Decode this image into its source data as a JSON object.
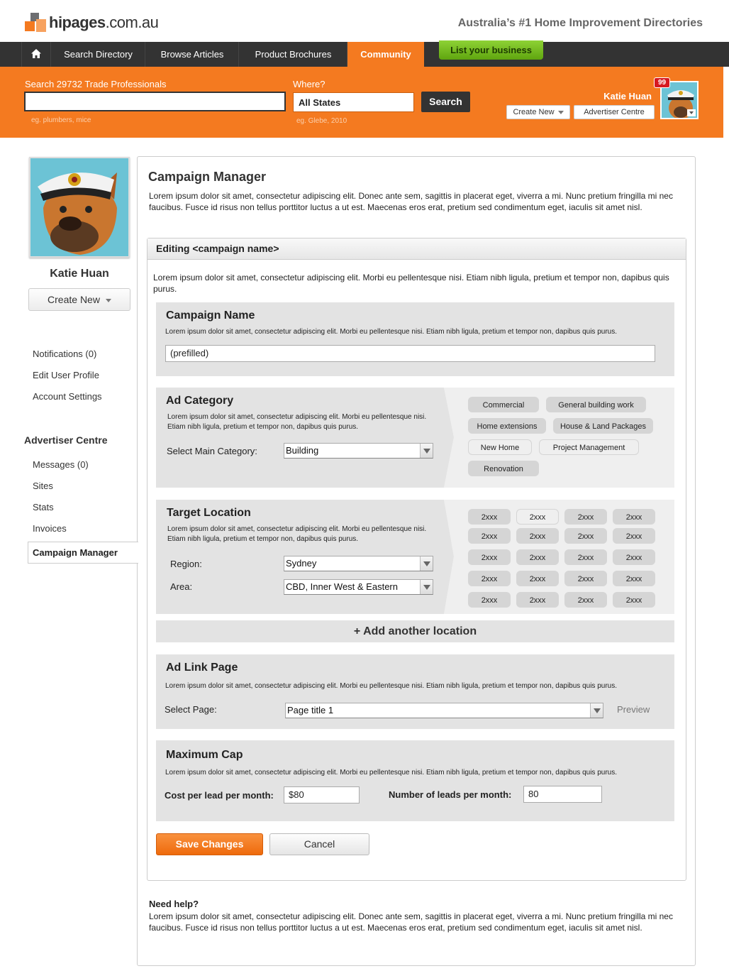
{
  "header": {
    "logo_text": "hipages",
    "logo_domain": ".com.au",
    "tagline": "Australia’s #1 Home Improvement Directories"
  },
  "nav": {
    "items": [
      {
        "label": "Search Directory"
      },
      {
        "label": "Browse Articles"
      },
      {
        "label": "Product Brochures"
      },
      {
        "label": "Community"
      }
    ],
    "list_business": "List your business"
  },
  "search": {
    "label": "Search 29732 Trade Professionals",
    "value": "",
    "hint": "eg. plumbers, mice",
    "where_label": "Where?",
    "where_value": "All States",
    "where_hint": "eg. Glebe, 2010",
    "button": "Search"
  },
  "user": {
    "name": "Katie Huan",
    "notifications_badge": "99",
    "create_new": "Create New",
    "advertiser_centre": "Advertiser Centre"
  },
  "sidebar": {
    "name": "Katie Huan",
    "create_new": "Create New",
    "links": [
      "Notifications (0)",
      "Edit User Profile",
      "Account Settings"
    ],
    "advertiser_heading": "Advertiser Centre",
    "advertiser_links": [
      "Messages (0)",
      "Sites",
      "Stats",
      "Invoices"
    ],
    "active_link": "Campaign Manager"
  },
  "main": {
    "title": "Campaign Manager",
    "intro": "Lorem ipsum dolor sit amet, consectetur adipiscing elit. Donec ante sem, sagittis in placerat eget, viverra a mi. Nunc pretium fringilla mi nec faucibus. Fusce id risus non tellus porttitor luctus a ut est. Maecenas eros erat, pretium sed condimentum eget, iaculis sit amet nisl.",
    "edit_header": "Editing <campaign name>",
    "edit_intro": "Lorem ipsum dolor sit amet, consectetur adipiscing elit. Morbi eu pellentesque nisi. Etiam nibh ligula, pretium et tempor non, dapibus quis purus.",
    "campaign_name": {
      "title": "Campaign Name",
      "desc": "Lorem ipsum dolor sit amet, consectetur adipiscing elit. Morbi eu pellentesque nisi. Etiam nibh ligula, pretium et tempor non, dapibus quis purus.",
      "value": "(prefilled)"
    },
    "ad_category": {
      "title": "Ad Category",
      "desc": "Lorem ipsum dolor sit amet, consectetur adipiscing elit. Morbi eu pellentesque nisi. Etiam nibh ligula, pretium et tempor non, dapibus quis purus.",
      "select_label": "Select Main Category:",
      "select_value": "Building",
      "chips": [
        "Commercial",
        "General building work",
        "Home extensions",
        "House & Land Packages",
        "New Home",
        "Project Management",
        "Renovation"
      ]
    },
    "target_location": {
      "title": "Target Location",
      "desc": "Lorem ipsum dolor sit amet, consectetur adipiscing elit. Morbi eu pellentesque nisi. Etiam nibh ligula, pretium et tempor non, dapibus quis purus.",
      "region_label": "Region:",
      "region_value": "Sydney",
      "area_label": "Area:",
      "area_value": "CBD, Inner West & Eastern",
      "postcodes": [
        "2xxx",
        "2xxx",
        "2xxx",
        "2xxx",
        "2xxx",
        "2xxx",
        "2xxx",
        "2xxx",
        "2xxx",
        "2xxx",
        "2xxx",
        "2xxx",
        "2xxx",
        "2xxx",
        "2xxx",
        "2xxx",
        "2xxx",
        "2xxx",
        "2xxx",
        "2xxx"
      ]
    },
    "add_location": "+ Add another location",
    "ad_link": {
      "title": "Ad Link Page",
      "desc": "Lorem ipsum dolor sit amet, consectetur adipiscing elit. Morbi eu pellentesque nisi. Etiam nibh ligula, pretium et tempor non, dapibus quis purus.",
      "select_label": "Select Page:",
      "select_value": "Page title 1",
      "preview": "Preview"
    },
    "max_cap": {
      "title": "Maximum Cap",
      "desc": "Lorem ipsum dolor sit amet, consectetur adipiscing elit. Morbi eu pellentesque nisi. Etiam nibh ligula, pretium et tempor non, dapibus quis purus.",
      "cost_label": "Cost per lead per month:",
      "cost_value": "$80",
      "leads_label": "Number of leads per month:",
      "leads_value": "80"
    },
    "save": "Save Changes",
    "cancel": "Cancel",
    "help_title": "Need help?",
    "help_text": "Lorem ipsum dolor sit amet, consectetur adipiscing elit. Donec ante sem, sagittis in placerat eget, viverra a mi. Nunc pretium fringilla mi nec faucibus. Fusce id risus non tellus porttitor luctus a ut est. Maecenas eros erat, pretium sed condimentum eget, iaculis sit amet nisl."
  },
  "colors": {
    "brand_orange": "#f47a20",
    "nav_dark": "#333333",
    "cta_green": "#6cb51a"
  }
}
